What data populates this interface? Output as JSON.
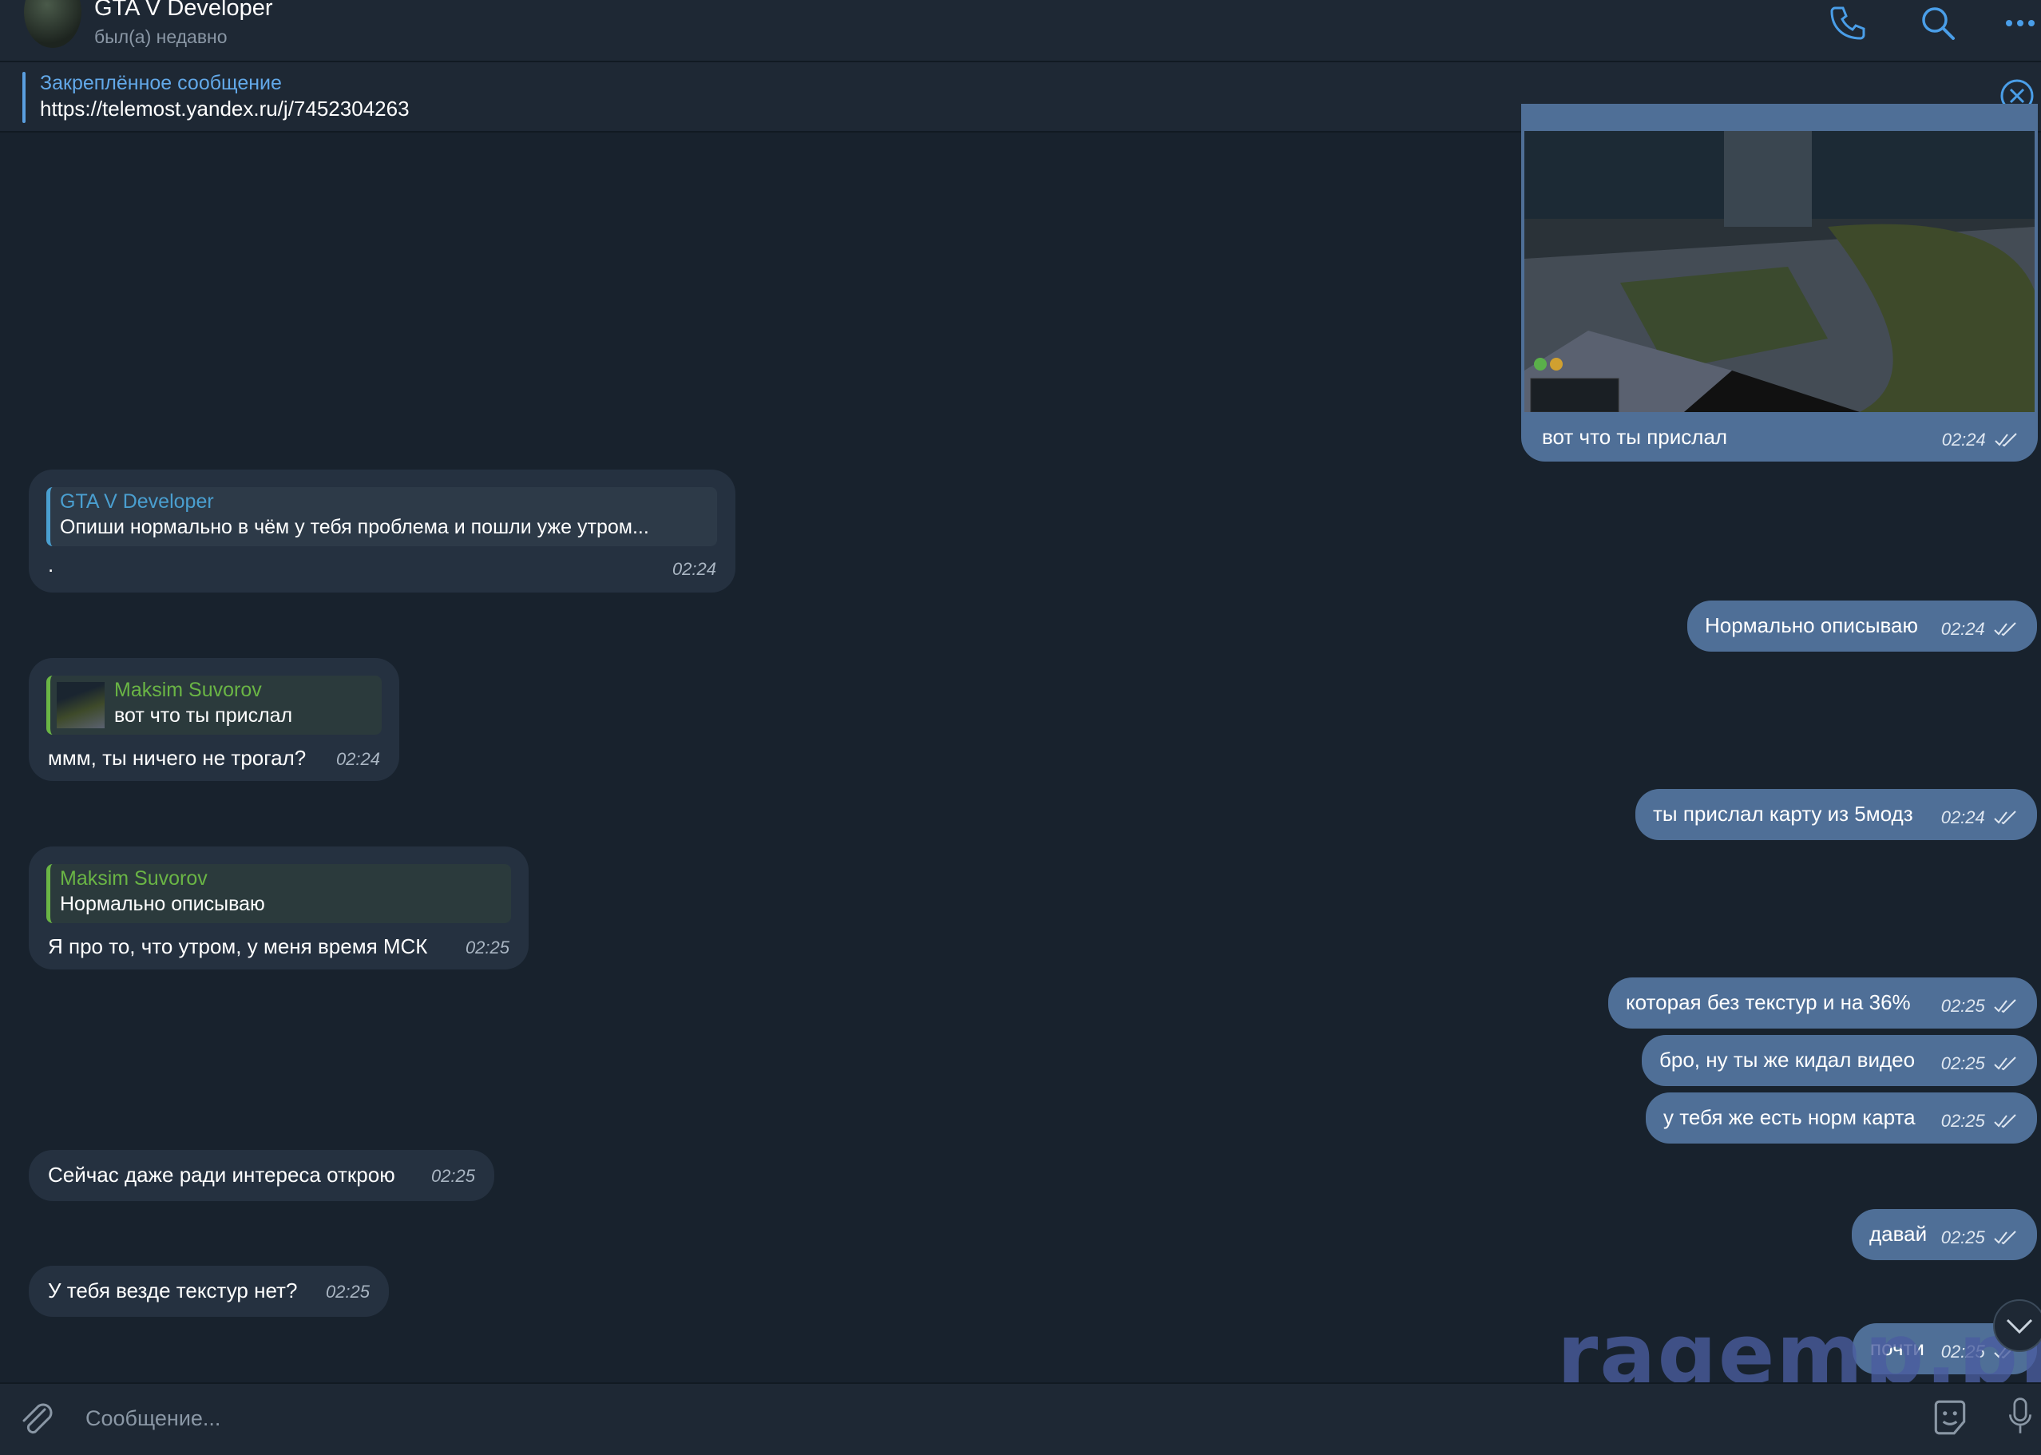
{
  "header": {
    "title": "GTA V Developer",
    "status": "был(а) недавно",
    "icons": [
      "phone-icon",
      "search-icon",
      "more-icon"
    ]
  },
  "pinned": {
    "label": "Закреплённое сообщение",
    "text": "https://telemost.yandex.ru/j/7452304263"
  },
  "messages": [
    {
      "dir": "out",
      "text": "вот что  ты прислал",
      "time": "02:24",
      "media": "gta-map-screenshot"
    },
    {
      "dir": "in",
      "reply_name": "GTA V Developer",
      "reply_text": "Опиши нормально в чём  у тебя проблема и пошли уже утром...",
      "text": ".",
      "time": "02:24"
    },
    {
      "dir": "out",
      "text": "Нормально описываю",
      "time": "02:24"
    },
    {
      "dir": "in",
      "reply_name": "Maksim Suvorov",
      "reply_text": "вот что  ты прислал",
      "text": "ммм, ты ничего не трогал?",
      "time": "02:24"
    },
    {
      "dir": "out",
      "text": "ты прислал карту из 5модз",
      "time": "02:24"
    },
    {
      "dir": "in",
      "reply_name": "Maksim Suvorov",
      "reply_text": "Нормально описываю",
      "text": "Я про  то, что утром, у меня время МСК",
      "time": "02:25"
    },
    {
      "dir": "out",
      "text": "которая без текстур и на 36%",
      "time": "02:25"
    },
    {
      "dir": "out",
      "text": "бро, ну ты же кидал видео",
      "time": "02:25"
    },
    {
      "dir": "out",
      "text": "у тебя же есть норм карта",
      "time": "02:25"
    },
    {
      "dir": "in",
      "text": "Сейчас даже ради интереса открою",
      "time": "02:25"
    },
    {
      "dir": "out",
      "text": "давай",
      "time": "02:25"
    },
    {
      "dir": "in",
      "text": "У тебя везде текстур нет?",
      "time": "02:25"
    },
    {
      "dir": "out",
      "text": "почти",
      "time": "02:25"
    }
  ],
  "input": {
    "placeholder": "Сообщение..."
  },
  "watermark": "ragemp.pro",
  "colors": {
    "background": "#18222d",
    "incoming": "#253140",
    "outgoing": "#4f6f97",
    "accent": "#5a9fe0",
    "reply_green": "#6ab545"
  }
}
